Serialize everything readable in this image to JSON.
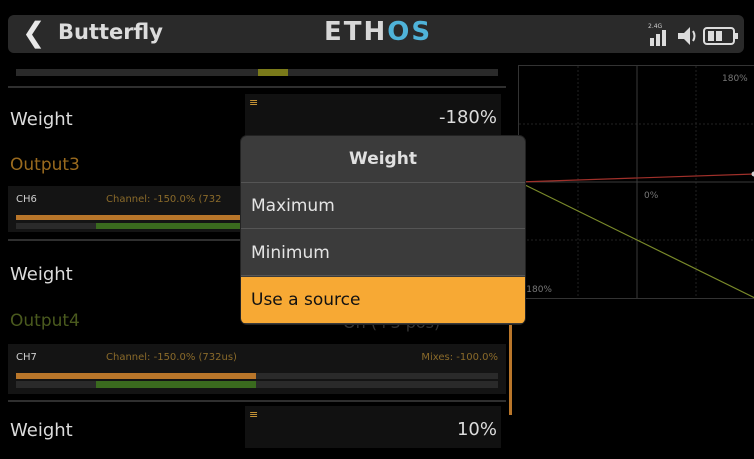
{
  "header": {
    "back_icon": "chevron-left-icon",
    "title": "Butterfly",
    "brand_a": "ETH",
    "brand_b": "OS",
    "rf_label": "2.4G"
  },
  "list": {
    "row1": {
      "label": "Weight",
      "value": "-180%"
    },
    "output3": {
      "label": "Output3"
    },
    "ch6": {
      "name": "CH6",
      "detail": "Channel: -150.0% (732"
    },
    "row2": {
      "label": "Weight"
    },
    "output4": {
      "label": "Output4",
      "hidden_value": "On (+3 pos)"
    },
    "ch7": {
      "name": "CH7",
      "detail": "Channel: -150.0% (732us)",
      "mixes": "Mixes: -100.0%"
    },
    "row3": {
      "label": "Weight",
      "value": "10%"
    }
  },
  "graph": {
    "top_label": "180%",
    "mid_label": "0%",
    "bottom_label": "-180%"
  },
  "dialog": {
    "title": "Weight",
    "options": [
      "Maximum",
      "Minimum",
      "Use a source"
    ],
    "selected": "Use a source"
  },
  "colors": {
    "accent": "#f7a934",
    "brand_accent": "#4fb3d9",
    "output_label": "#9a6a1e"
  }
}
